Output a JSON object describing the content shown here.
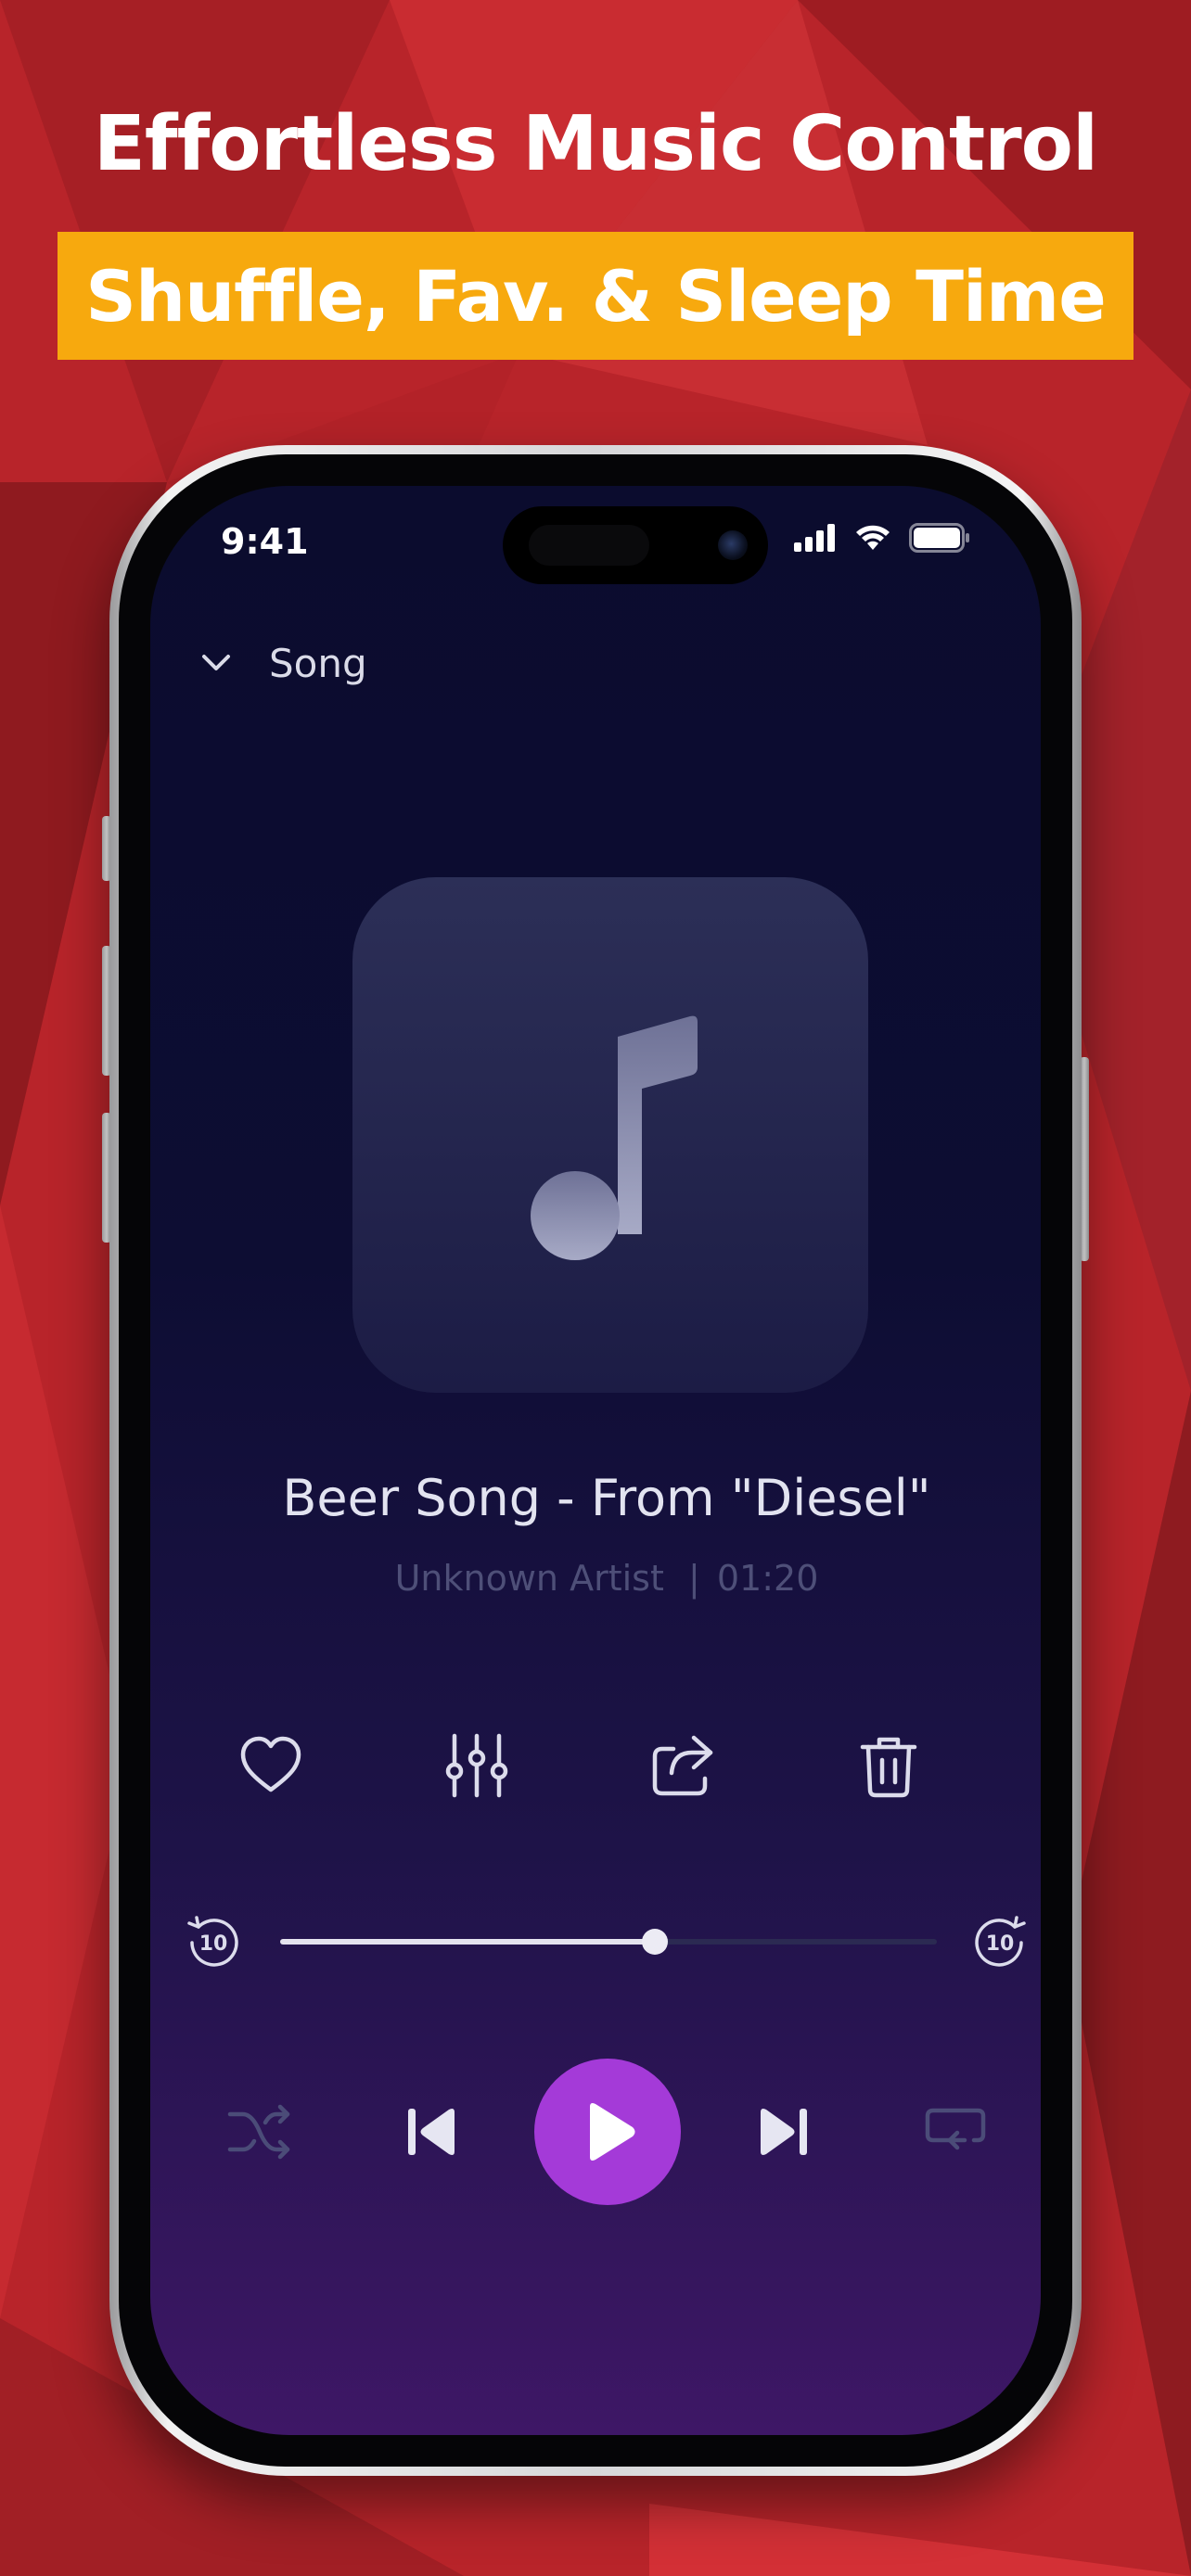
{
  "promo": {
    "headline": "Effortless Music Control",
    "ribbon": "Shuffle, Fav. & Sleep Time",
    "accent_color": "#f7a90e",
    "background_color": "#b8242a"
  },
  "status_bar": {
    "time": "9:41",
    "icons": [
      "cellular-signal-icon",
      "wifi-icon",
      "battery-icon"
    ]
  },
  "nav": {
    "back_icon": "chevron-down-icon",
    "title": "Song"
  },
  "player": {
    "artwork_icon": "music-note-icon",
    "song_title": "Beer Song - From \"Diesel\"",
    "artist": "Unknown Artist",
    "separator": "|",
    "duration": "01:20",
    "progress": 0.57,
    "rewind_seconds": "10",
    "forward_seconds": "10",
    "play_color": "#a43ad8"
  },
  "actions": [
    "heart-icon",
    "equalizer-icon",
    "share-icon",
    "trash-icon"
  ],
  "controls": [
    "shuffle-icon",
    "previous-icon",
    "play-icon",
    "next-icon",
    "repeat-icon"
  ]
}
